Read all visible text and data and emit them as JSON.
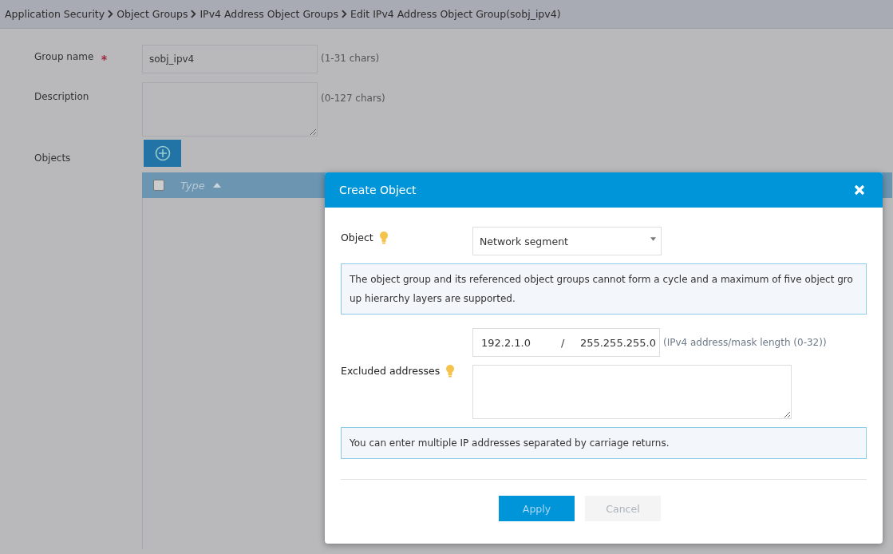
{
  "breadcrumb": [
    "Application Security",
    "Object Groups",
    "IPv4 Address Object Groups",
    "Edit IPv4 Address Object Group(sobj_ipv4)"
  ],
  "form": {
    "group_name": {
      "label": "Group name",
      "required": true,
      "value": "sobj_ipv4",
      "hint": "(1-31 chars)"
    },
    "description": {
      "label": "Description",
      "hint": "(0-127 chars)"
    },
    "objects": {
      "label": "Objects",
      "table": {
        "columns": [
          {
            "label": "Type",
            "sorted": true
          }
        ],
        "select_all_checked": false
      }
    }
  },
  "dialog": {
    "title": "Create Object",
    "object": {
      "label": "Object",
      "value": "Network segment"
    },
    "info": "The object group and its referenced object groups cannot form a cycle and a maximum of five object group hierarchy layers are supported.",
    "address": {
      "ip": "192.2.1.0",
      "separator": "/",
      "mask": "255.255.255.0",
      "hint": "(IPv4 address/mask length (0-32))"
    },
    "excluded": {
      "label": "Excluded addresses"
    },
    "excluded_info": "You can enter multiple IP addresses separated by carriage returns.",
    "buttons": [
      {
        "label": "Apply",
        "kind": "primary"
      },
      {
        "label": "Cancel",
        "kind": "secondary"
      }
    ]
  }
}
